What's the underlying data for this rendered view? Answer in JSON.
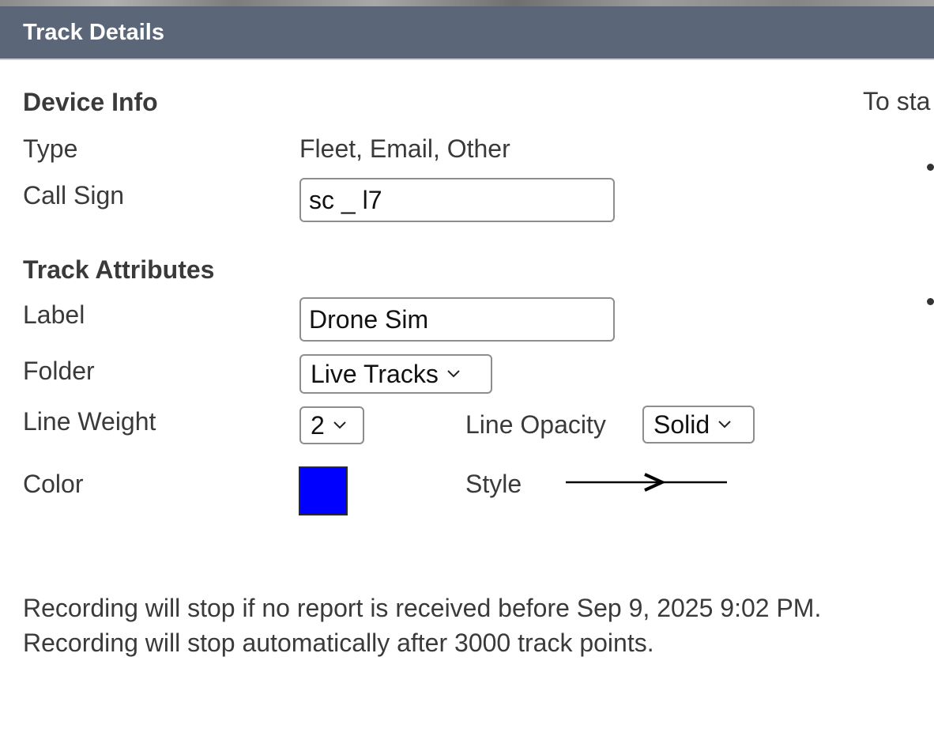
{
  "dialog": {
    "title": "Track Details"
  },
  "device_info": {
    "heading": "Device Info",
    "type_label": "Type",
    "type_value": "Fleet, Email, Other",
    "call_sign_label": "Call Sign",
    "call_sign_value": "sc _ l7"
  },
  "track_attributes": {
    "heading": "Track Attributes",
    "label_label": "Label",
    "label_value": "Drone Sim",
    "folder_label": "Folder",
    "folder_selected": "Live Tracks",
    "line_weight_label": "Line Weight",
    "line_weight_selected": "2",
    "line_opacity_label": "Line Opacity",
    "line_opacity_selected": "Solid",
    "color_label": "Color",
    "color_value": "#0000ff",
    "style_label": "Style",
    "style_icon": "arrow-line-icon"
  },
  "footer": {
    "line1": "Recording will stop if no report is received before Sep 9, 2025 9:02 PM.",
    "line2": "Recording will stop automatically after 3000 track points."
  },
  "right_panel": {
    "text": "To sta"
  },
  "colors": {
    "titlebar": "#5b6678",
    "title_text": "#ffffff",
    "swatch": "#0000ff"
  }
}
